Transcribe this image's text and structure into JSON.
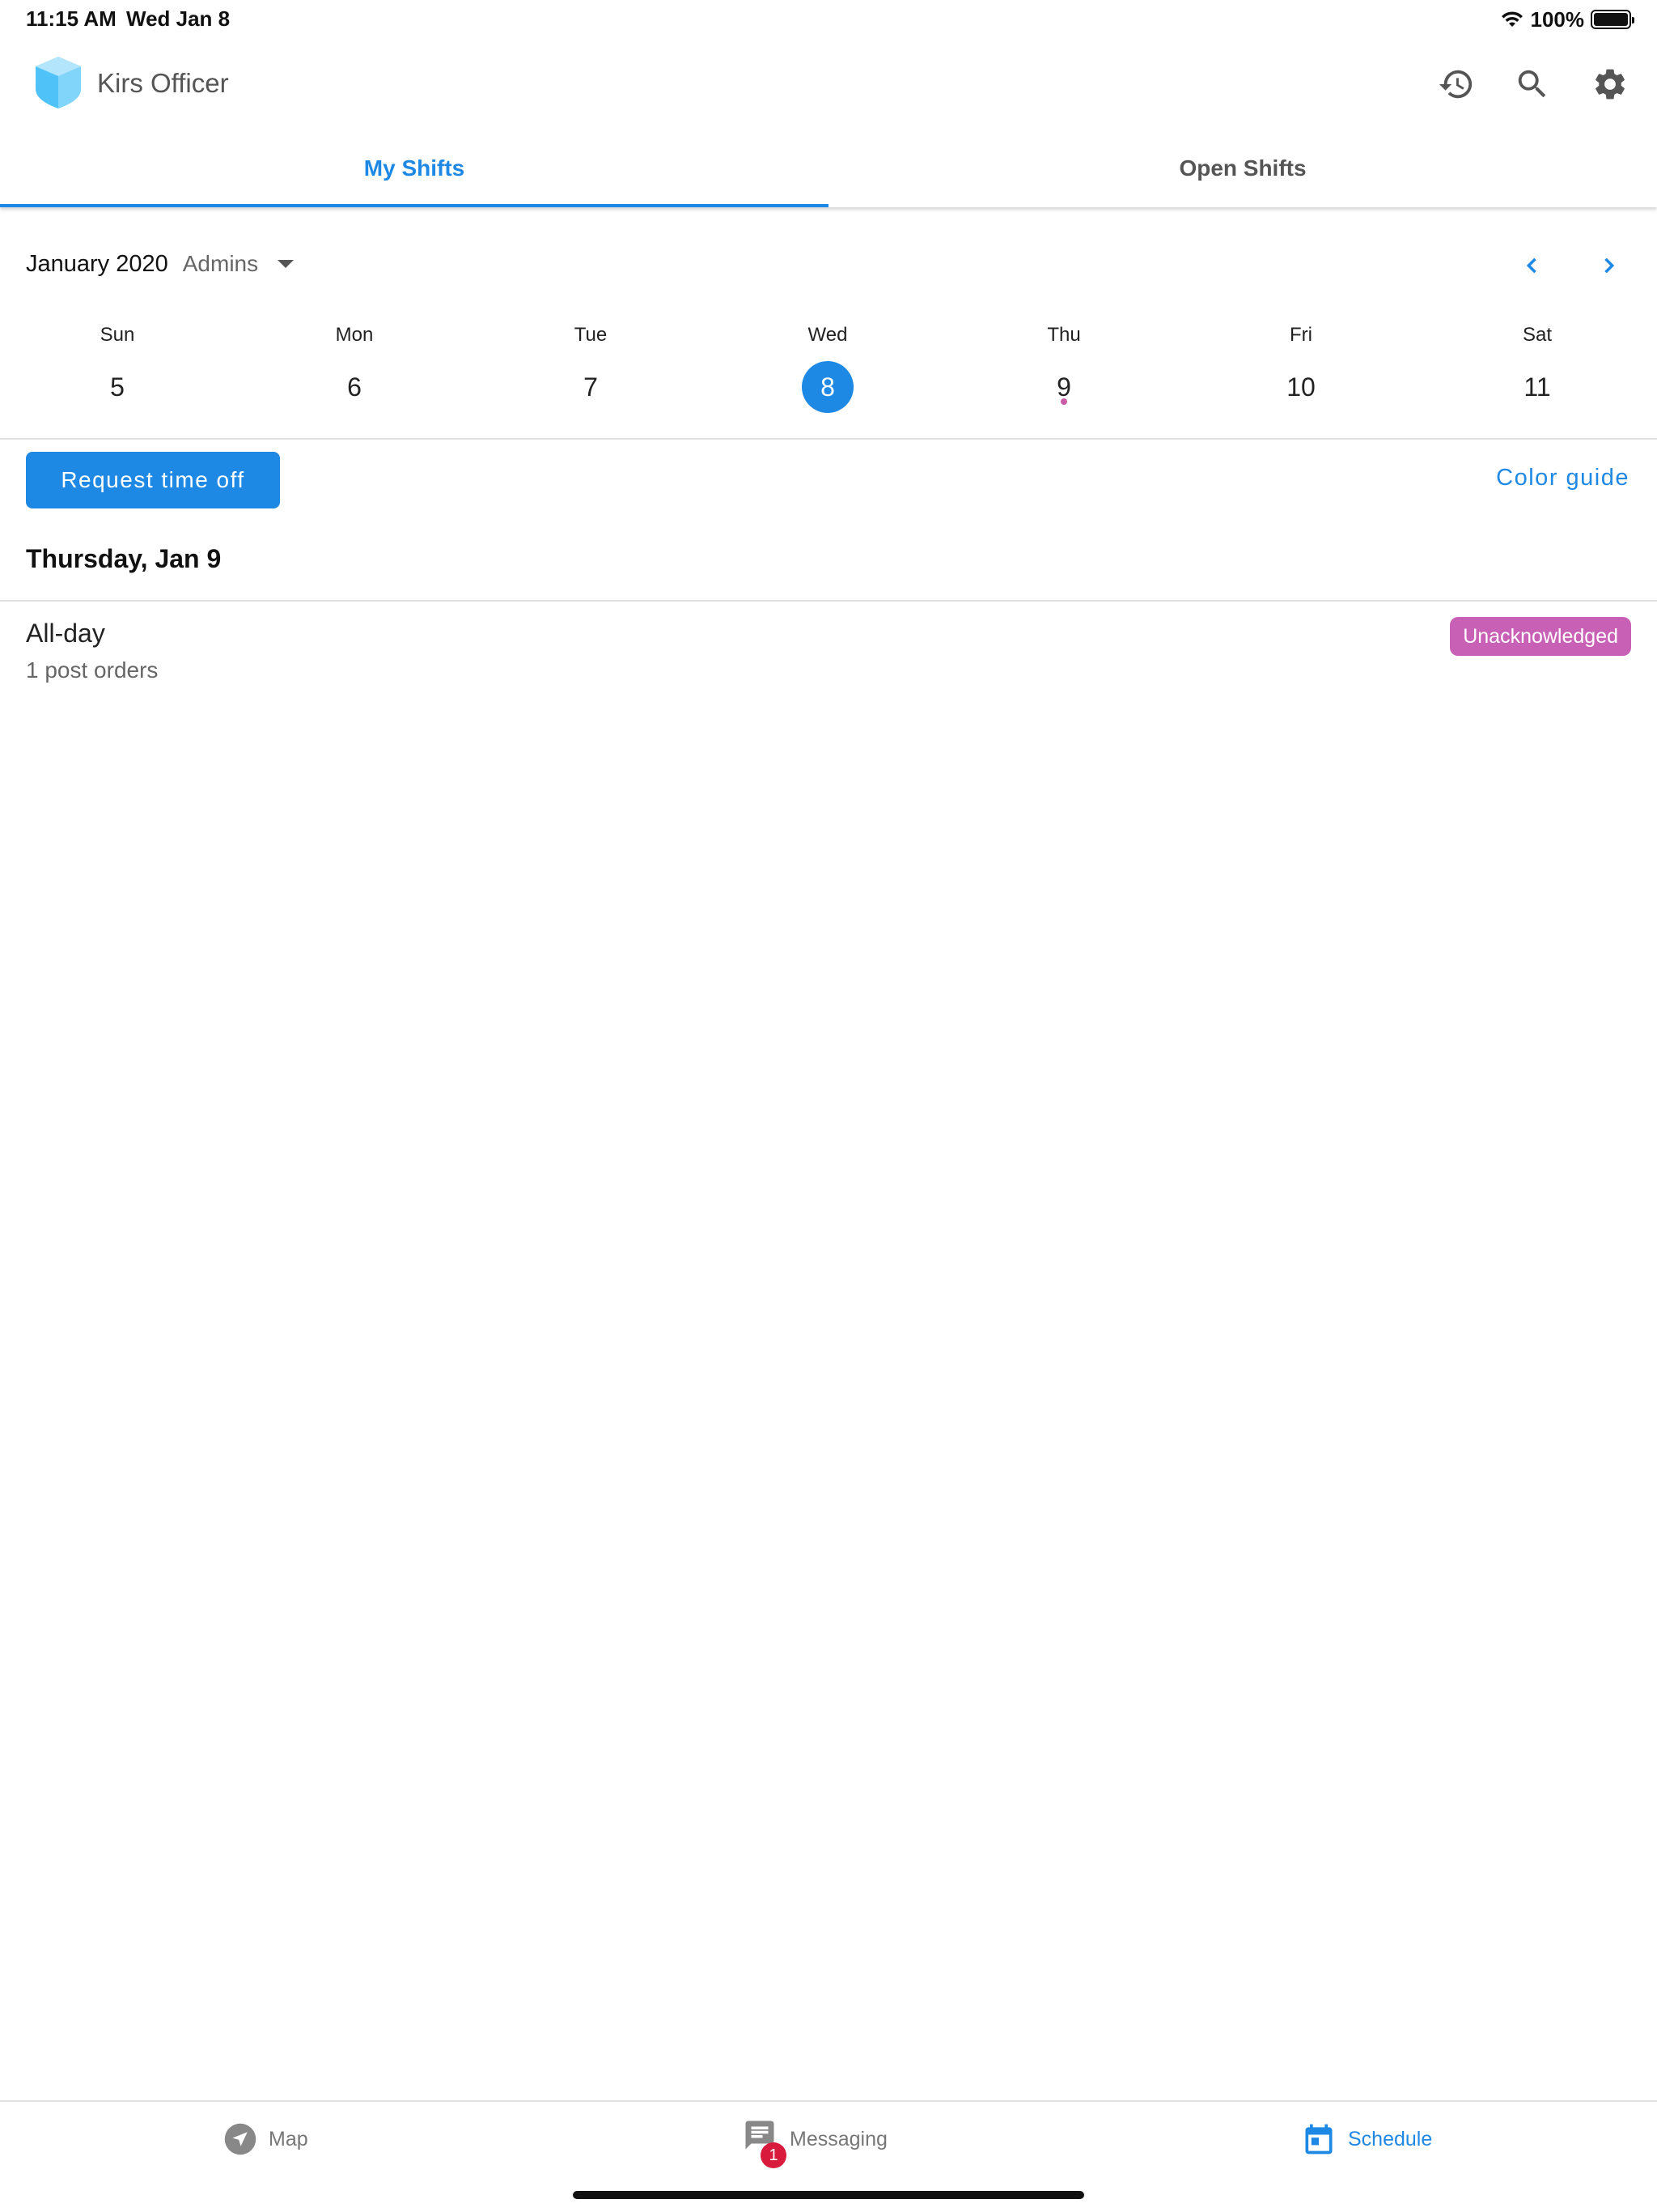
{
  "status_bar": {
    "time": "11:15 AM",
    "date": "Wed Jan 8",
    "battery_percent": "100%",
    "battery_level": 1.0
  },
  "app_bar": {
    "title": "Kirs Officer",
    "logo_icon": "shield-logo-icon",
    "actions": [
      {
        "icon": "history-icon"
      },
      {
        "icon": "search-icon"
      },
      {
        "icon": "gear-icon"
      }
    ]
  },
  "tabs": [
    {
      "label": "My Shifts",
      "active": true
    },
    {
      "label": "Open Shifts",
      "active": false
    }
  ],
  "calendar": {
    "month": "January 2020",
    "group": "Admins",
    "days": [
      {
        "name": "Sun",
        "number": "5",
        "selected": false,
        "has_event": false
      },
      {
        "name": "Mon",
        "number": "6",
        "selected": false,
        "has_event": false
      },
      {
        "name": "Tue",
        "number": "7",
        "selected": false,
        "has_event": false
      },
      {
        "name": "Wed",
        "number": "8",
        "selected": true,
        "has_event": false
      },
      {
        "name": "Thu",
        "number": "9",
        "selected": false,
        "has_event": true
      },
      {
        "name": "Fri",
        "number": "10",
        "selected": false,
        "has_event": false
      },
      {
        "name": "Sat",
        "number": "11",
        "selected": false,
        "has_event": false
      }
    ]
  },
  "actions": {
    "request_time_off": "Request time off",
    "color_guide": "Color guide"
  },
  "schedule": {
    "day_heading": "Thursday, Jan 9",
    "shifts": [
      {
        "title": "All-day",
        "subtitle": "1 post orders",
        "status": "Unacknowledged"
      }
    ]
  },
  "bottom_nav": {
    "items": [
      {
        "label": "Map",
        "icon": "navigation-arrow-icon",
        "active": false
      },
      {
        "label": "Messaging",
        "icon": "message-icon",
        "active": false,
        "badge": "1"
      },
      {
        "label": "Schedule",
        "icon": "calendar-icon",
        "active": true
      }
    ]
  },
  "colors": {
    "accent": "#1e88e5",
    "badge_unacknowledged": "#c860b5",
    "event_dot": "#cc5ba8",
    "notification_badge": "#d81b3c"
  }
}
